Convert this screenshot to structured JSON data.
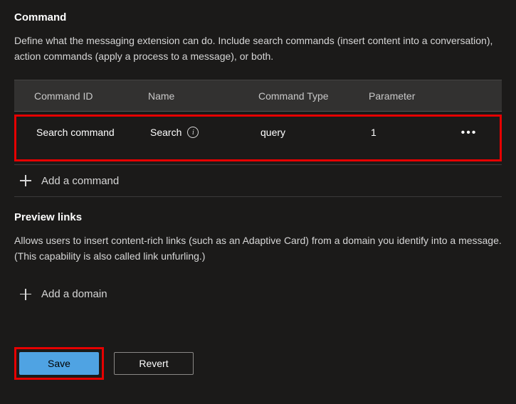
{
  "command_section": {
    "heading": "Command",
    "description": "Define what the messaging extension can do. Include search commands (insert content into a conversation), action commands (apply a process to a message), or both.",
    "columns": {
      "id": "Command ID",
      "name": "Name",
      "type": "Command Type",
      "parameter": "Parameter"
    },
    "rows": [
      {
        "id": "Search command",
        "name": "Search",
        "type": "query",
        "parameter": "1"
      }
    ],
    "add_label": "Add a command"
  },
  "preview_section": {
    "heading": "Preview links",
    "description": "Allows users to insert content-rich links (such as an Adaptive Card) from a domain you identify into a message. (This capability is also called link unfurling.)",
    "add_label": "Add a domain"
  },
  "buttons": {
    "save": "Save",
    "revert": "Revert"
  },
  "highlight_color": "#e60000",
  "primary_color": "#4fa3e3"
}
